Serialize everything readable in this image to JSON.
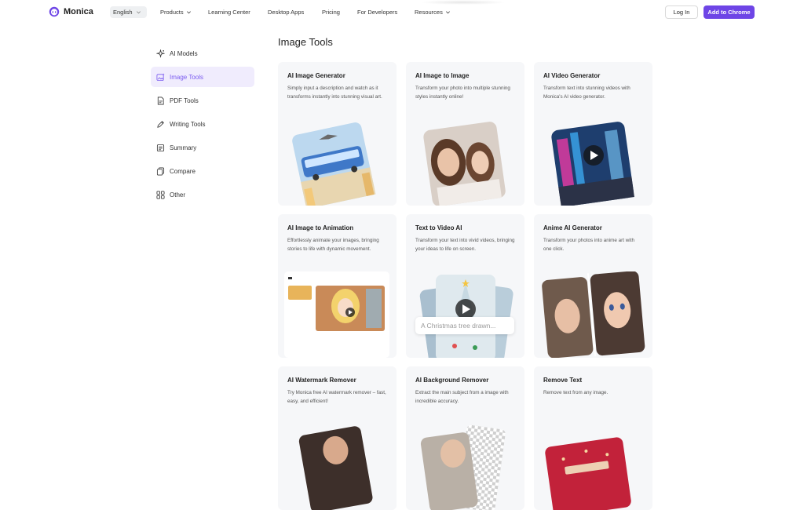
{
  "nav": {
    "brand": "Monica",
    "language": "English",
    "links": [
      {
        "label": "Products",
        "has_menu": true
      },
      {
        "label": "Learning Center",
        "has_menu": false
      },
      {
        "label": "Desktop Apps",
        "has_menu": false
      },
      {
        "label": "Pricing",
        "has_menu": false
      },
      {
        "label": "For Developers",
        "has_menu": false
      },
      {
        "label": "Resources",
        "has_menu": true
      }
    ],
    "login": "Log In",
    "add_to_chrome": "Add to Chrome",
    "accent": "#6e45e6"
  },
  "sidebar": {
    "items": [
      {
        "label": "AI Models",
        "icon": "sparkle-icon",
        "active": false
      },
      {
        "label": "Image Tools",
        "icon": "image-sparkle-icon",
        "active": true
      },
      {
        "label": "PDF Tools",
        "icon": "pdf-icon",
        "active": false
      },
      {
        "label": "Writing Tools",
        "icon": "pen-icon",
        "active": false
      },
      {
        "label": "Summary",
        "icon": "summary-icon",
        "active": false
      },
      {
        "label": "Compare",
        "icon": "compare-icon",
        "active": false
      },
      {
        "label": "Other",
        "icon": "grid-icon",
        "active": false
      }
    ]
  },
  "main": {
    "title": "Image Tools",
    "cards": [
      {
        "title": "AI Image Generator",
        "desc": "Simply input a description and watch as it transforms instantly into stunning visual art.",
        "art": "flying-bus-illustration"
      },
      {
        "title": "AI Image to Image",
        "desc": "Transform your photo into multiple stunning styles instantly online!",
        "art": "two-portraits-photo"
      },
      {
        "title": "AI Video Generator",
        "desc": "Transform text into stunning videos with Monica's AI video generator.",
        "art": "neon-city-video-thumbnail"
      },
      {
        "title": "AI Image to Animation",
        "desc": "Effortlessly animate your images, bringing stories to life with dynamic movement.",
        "art": "anime-animation-preview"
      },
      {
        "title": "Text to Video AI",
        "desc": "Transform your text into vivid videos, bringing your ideas to life on screen.",
        "art": "christmas-video-thumbnail",
        "prompt": "A Christmas tree drawn..."
      },
      {
        "title": "Anime AI Generator",
        "desc": "Transform your photos into anime art with one click.",
        "art": "photo-vs-anime-portrait"
      },
      {
        "title": "AI Watermark Remover",
        "desc": "Try Monica free AI watermark remover – fast, easy, and efficient!",
        "art": "watermark-remover-preview"
      },
      {
        "title": "AI Background Remover",
        "desc": "Extract the main subject from a image with incredible accuracy.",
        "art": "background-remover-preview"
      },
      {
        "title": "Remove Text",
        "desc": "Remove text from any image.",
        "art": "remove-text-preview"
      }
    ]
  }
}
